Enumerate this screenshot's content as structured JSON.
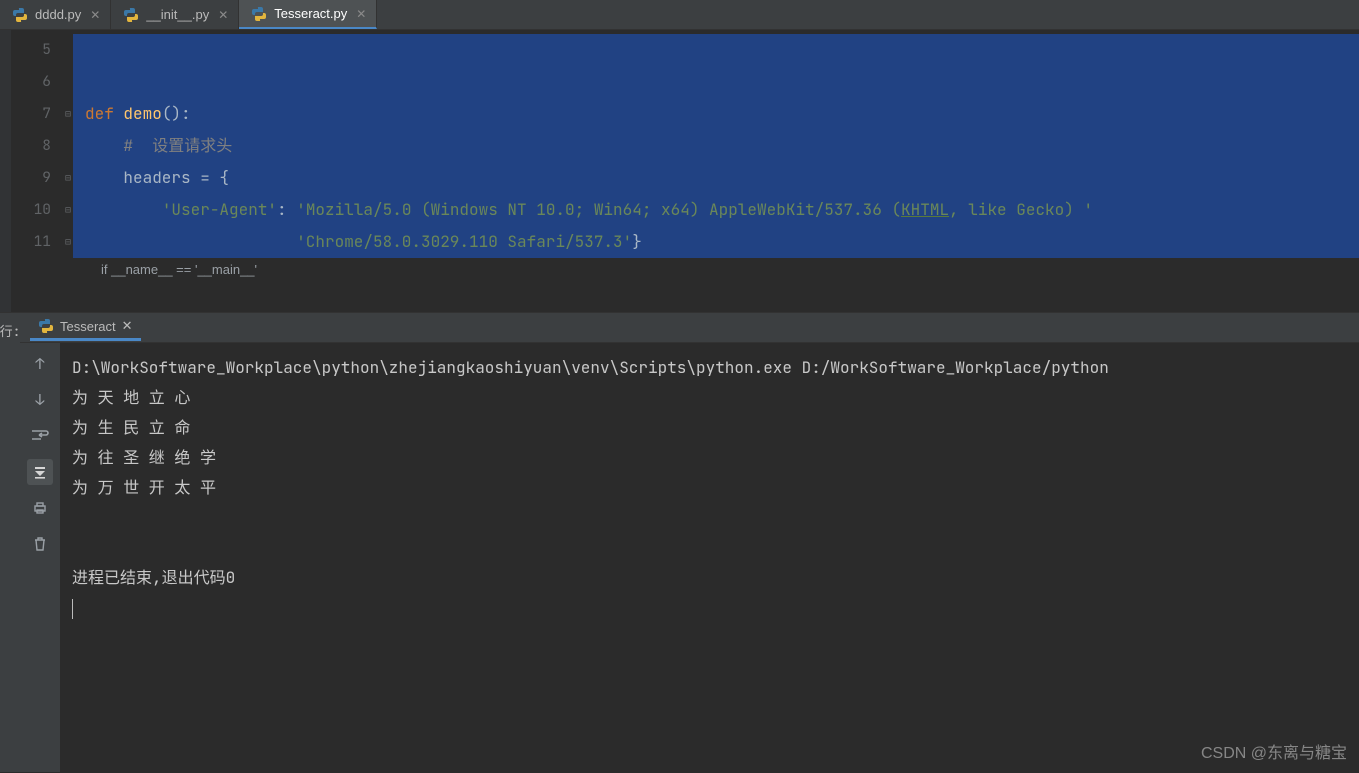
{
  "tabs": [
    {
      "label": "dddd.py",
      "active": false
    },
    {
      "label": "__init__.py",
      "active": false
    },
    {
      "label": "Tesseract.py",
      "active": true
    }
  ],
  "gutter": {
    "start": 5,
    "end": 11
  },
  "code": {
    "l7_def": "def ",
    "l7_fn": "demo",
    "l7_rest": "():",
    "l8_cmt": "#  设置请求头",
    "l9_var": "headers = {",
    "l10_key": "'User-Agent'",
    "l10_sep": ": ",
    "l10_val": "'Mozilla/5.0 (Windows NT 10.0; Win64; x64) AppleWebKit/537.36 (",
    "l10_khtml": "KHTML",
    "l10_val2": ", like Gecko) '",
    "l11_val": "'Chrome/58.0.3029.110 Safari/537.3'",
    "l11_brace": "}"
  },
  "breadcrumb": "if __name__ == '__main__'",
  "run": {
    "side_label": "行:",
    "tab_label": "Tesseract",
    "lines": [
      "D:\\WorkSoftware_Workplace\\python\\zhejiangkaoshiyuan\\venv\\Scripts\\python.exe D:/WorkSoftware_Workplace/python",
      "为 天 地 立 心",
      "为 生 民 立 命",
      "为 往 圣 继 绝 学",
      "为 万 世 开 太 平",
      "",
      "",
      "进程已结束,退出代码0"
    ]
  },
  "watermark": "CSDN @东离与糖宝"
}
